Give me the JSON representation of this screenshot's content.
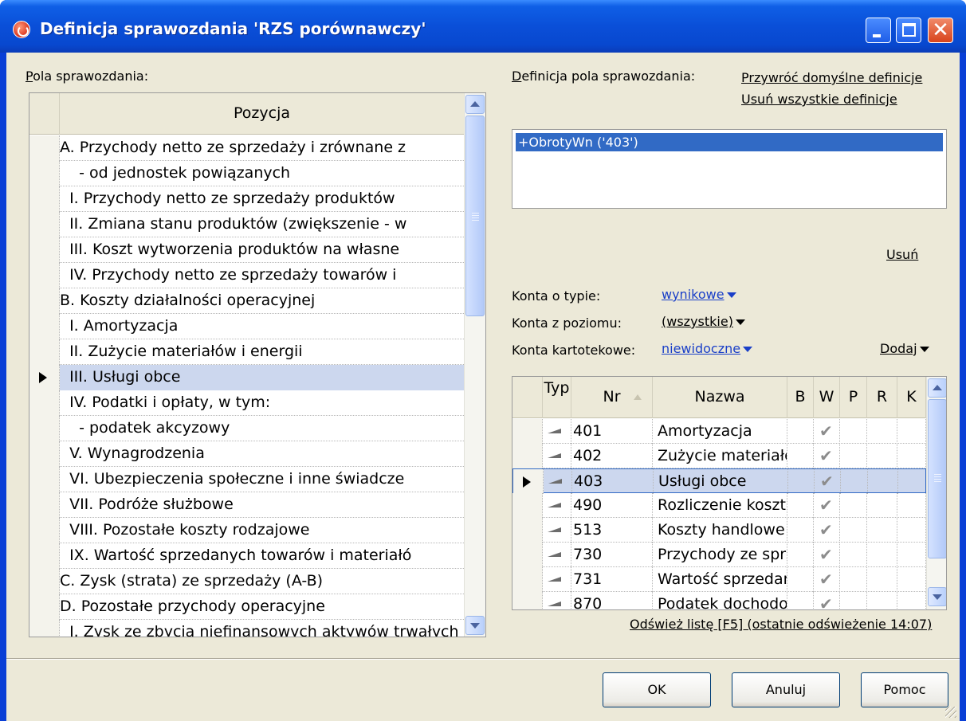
{
  "window": {
    "title": "Definicja sprawozdania 'RZS porównawczy'",
    "icon": "app-logo-icon",
    "controls": [
      "minimize-icon",
      "maximize-icon",
      "close-icon"
    ],
    "close_glyph": "✕"
  },
  "left": {
    "label": "Pola sprawozdania:",
    "column_header": "Pozycja",
    "selected_index": 9,
    "rows": [
      "A. Przychody netto ze sprzedaży i zrównane z",
      "    - od jednostek powiązanych",
      "  I. Przychody netto ze sprzedaży produktów",
      "  II. Zmiana stanu produktów (zwiększenie - w",
      "  III. Koszt wytworzenia produktów na własne",
      "  IV. Przychody netto ze sprzedaży towarów i",
      "B. Koszty działalności operacyjnej",
      "  I. Amortyzacja",
      "  II. Zużycie materiałów i energii",
      "  III. Usługi obce",
      "  IV. Podatki i opłaty, w tym:",
      "    - podatek akcyzowy",
      "  V. Wynagrodzenia",
      "  VI. Ubezpieczenia społeczne i inne świadcze",
      "  VII. Podróże służbowe",
      "  VIII. Pozostałe koszty rodzajowe",
      "  IX. Wartość sprzedanych towarów i materiałó",
      "C. Zysk (strata) ze sprzedaży (A-B)",
      "D. Pozostałe przychody operacyjne",
      "  I. Zysk ze zbycia niefinansowych aktywów trwałych"
    ]
  },
  "right": {
    "definition_label": "Definicja pola sprawozdania:",
    "restore_link": "Przywróć domyślne definicje",
    "clear_link": "Usuń wszystkie definicje",
    "definition_items": [
      "+ObrotyWn ('403')"
    ],
    "remove_link": "Usuń",
    "filters": [
      {
        "label": "Konta o typie:",
        "value": "wynikowe"
      },
      {
        "label": "Konta z poziomu:",
        "value": "(wszystkie)"
      },
      {
        "label": "Konta kartotekowe:",
        "value": "niewidoczne"
      }
    ],
    "add_link": "Dodaj",
    "accounts_header": {
      "typ": "Typ",
      "nr": "Nr",
      "nazwa": "Nazwa",
      "b": "B",
      "w": "W",
      "p": "P",
      "r": "R",
      "k": "K"
    },
    "accounts": [
      {
        "nr": "401",
        "nazwa": "Amortyzacja",
        "w": "✔"
      },
      {
        "nr": "402",
        "nazwa": "Zużycie materiałów",
        "w": "✔"
      },
      {
        "nr": "403",
        "nazwa": "Usługi obce",
        "w": "✔"
      },
      {
        "nr": "490",
        "nazwa": "Rozliczenie kosztów",
        "w": "✔"
      },
      {
        "nr": "513",
        "nazwa": "Koszty handlowe",
        "w": "✔"
      },
      {
        "nr": "730",
        "nazwa": "Przychody ze sprzedaży",
        "w": "✔"
      },
      {
        "nr": "731",
        "nazwa": "Wartość sprzedanych",
        "w": "✔"
      },
      {
        "nr": "870",
        "nazwa": "Podatek dochodowy",
        "w": "✔"
      }
    ],
    "selected_account_index": 2,
    "refresh_link": "Odśwież listę [F5] (ostatnie odświeżenie 14:07)"
  },
  "buttons": {
    "ok": "OK",
    "cancel": "Anuluj",
    "help": "Pomoc"
  },
  "colors": {
    "titlebar": "#0a4fd8",
    "dialog_bg": "#ece9d8",
    "selection": "#316ac5",
    "row_highlight": "#ccd7ee",
    "link_blue": "#1a3fc8"
  }
}
